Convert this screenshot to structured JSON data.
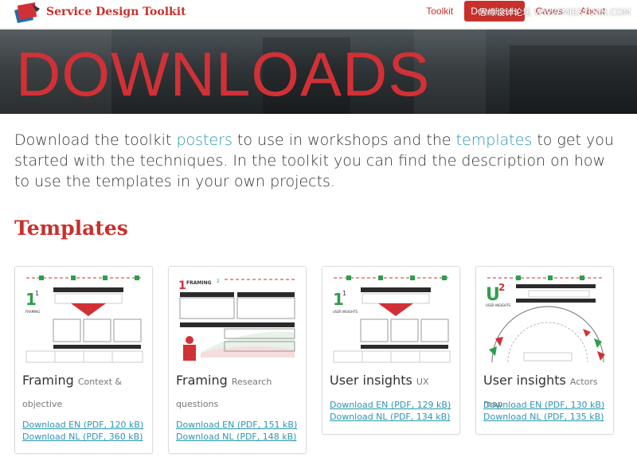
{
  "header": {
    "brand": "Service Design Toolkit",
    "nav": [
      "Toolkit",
      "Downloads",
      "Cases",
      "About"
    ],
    "active": "Downloads",
    "watermark": "思缘设计论坛 WWW.MISSYUAN.COM"
  },
  "hero": {
    "title": "DOWNLOADS"
  },
  "intro": {
    "part1": "Download the toolkit ",
    "link1": "posters",
    "part2": " to use in workshops and the ",
    "link2": "templates",
    "part3": " to get you started with the techniques. In the toolkit you can find the description on how to use the templates in your own projects."
  },
  "section": {
    "title": "Templates"
  },
  "cards": [
    {
      "title": "Framing",
      "subtitle": "Context & objective",
      "dl_en": "Download EN (PDF, 120 kB)",
      "dl_nl": "Download NL (PDF, 360 kB)"
    },
    {
      "title": "Framing",
      "subtitle": "Research questions",
      "dl_en": "Download EN (PDF, 151 kB)",
      "dl_nl": "Download NL (PDF, 148 kB)"
    },
    {
      "title": "User insights",
      "subtitle": "UX",
      "dl_en": "Download EN (PDF, 129 kB)",
      "dl_nl": "Download NL (PDF, 134 kB)"
    },
    {
      "title": "User insights",
      "subtitle": "Actors map",
      "dl_en": "Download EN (PDF, 130 kB)",
      "dl_nl": "Download NL (PDF, 135 kB)"
    }
  ],
  "thumbs": {
    "t1": {
      "num": "1",
      "sup": "1",
      "label": "FRAMING"
    },
    "t2": {
      "num": "1",
      "sup": "2",
      "label": "FRAMING"
    },
    "t3": {
      "num": "1",
      "sup": "1",
      "label": "USER INSIGHTS"
    },
    "t4": {
      "num": "U",
      "sup": "2",
      "label": "USER INSIGHTS"
    }
  },
  "colors": {
    "brand": "#c9302c",
    "link": "#2a96b4",
    "hero_text": "#d13136"
  }
}
